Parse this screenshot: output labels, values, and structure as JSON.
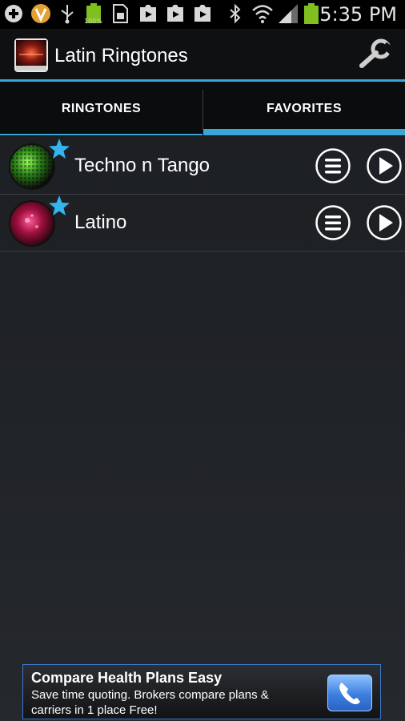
{
  "status_bar": {
    "time": "5:35 PM",
    "battery_percent_label": "100%",
    "icons": [
      "add-icon",
      "v-icon",
      "usb-icon",
      "battery-full-icon",
      "sd-card-icon",
      "play-store-icon",
      "play-store-icon",
      "play-store-icon",
      "bluetooth-icon",
      "wifi-icon",
      "signal-icon",
      "battery-icon"
    ]
  },
  "action_bar": {
    "title": "Latin Ringtones",
    "settings_icon": "wrench-icon"
  },
  "tabs": [
    {
      "label": "RINGTONES",
      "selected": false
    },
    {
      "label": "FAVORITES",
      "selected": true
    }
  ],
  "favorites": [
    {
      "title": "Techno n Tango",
      "favorited": true
    },
    {
      "title": "Latino",
      "favorited": true
    }
  ],
  "ad": {
    "title": "Compare Health Plans Easy",
    "body": "Save time quoting. Brokers compare plans & carriers in 1 place Free!",
    "icon": "phone-icon"
  },
  "colors": {
    "accent": "#38a7d6",
    "star": "#34b5f0",
    "background": "#1f2226"
  }
}
